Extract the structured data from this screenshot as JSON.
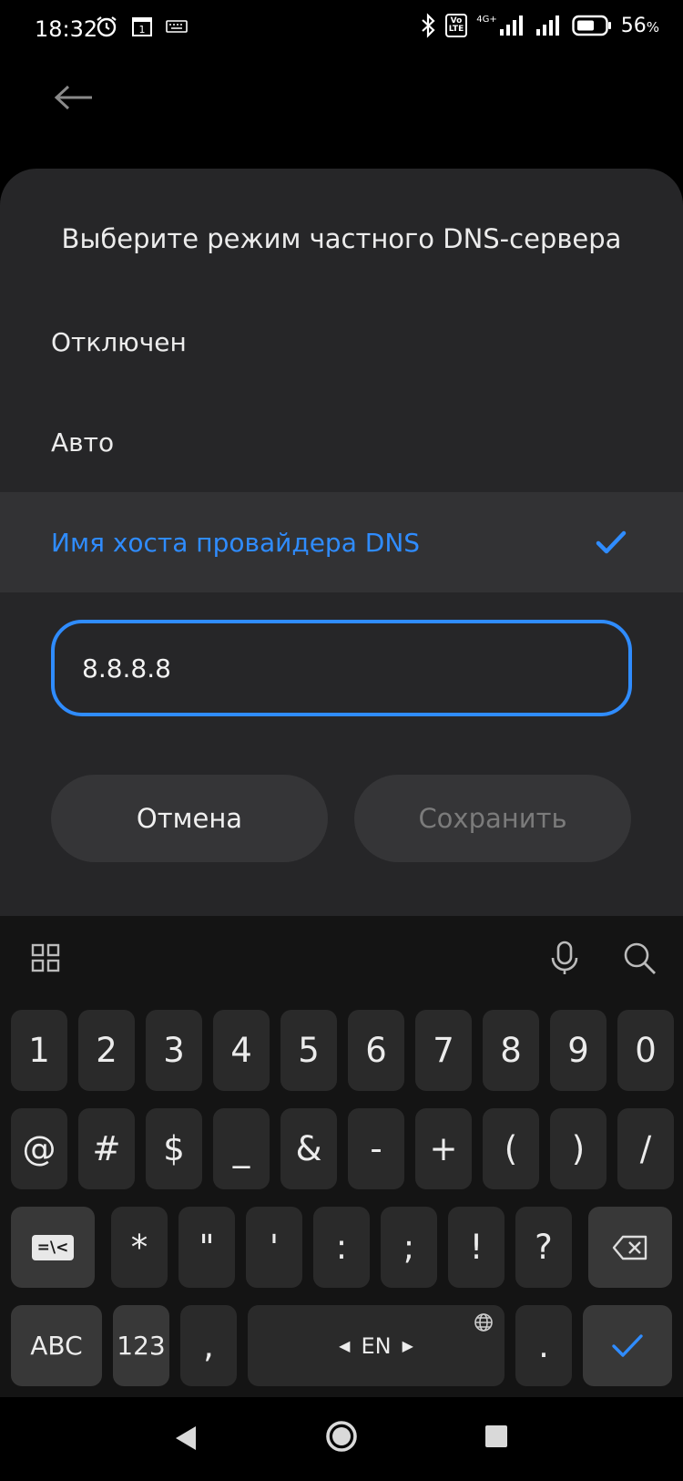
{
  "status_bar": {
    "time": "18:32",
    "volte_top": "Vo",
    "volte_bottom": "LTE",
    "network": "4G+",
    "battery": "56",
    "battery_unit": "%",
    "icons": [
      "alarm-icon",
      "calendar-icon",
      "keyboard-icon",
      "bluetooth-icon",
      "signal-icon",
      "battery-icon"
    ]
  },
  "dialog": {
    "title": "Выберите режим частного DNS-сервера",
    "options": [
      {
        "label": "Отключен",
        "selected": false
      },
      {
        "label": "Авто",
        "selected": false
      },
      {
        "label": "Имя хоста провайдера DNS",
        "selected": true
      }
    ],
    "hostname_value": "8.8.8.8",
    "cancel_label": "Отмена",
    "save_label": "Сохранить",
    "accent_color": "#2f8cff"
  },
  "keyboard": {
    "toolbar_icons": [
      "grid-icon",
      "microphone-icon",
      "search-icon"
    ],
    "row1": [
      "1",
      "2",
      "3",
      "4",
      "5",
      "6",
      "7",
      "8",
      "9",
      "0"
    ],
    "row2": [
      "@",
      "#",
      "$",
      "_",
      "&",
      "-",
      "+",
      "(",
      ")",
      "/"
    ],
    "row3": [
      "*",
      "\"",
      "'",
      ":",
      ";",
      "!",
      "?"
    ],
    "row3_left_label": "=\\<",
    "abc_label": "ABC",
    "num_label": "123",
    "comma_label": ",",
    "space_label": "EN",
    "period_label": "."
  },
  "nav_bar": {
    "icons": [
      "back-triangle-icon",
      "home-circle-icon",
      "recents-square-icon"
    ]
  }
}
